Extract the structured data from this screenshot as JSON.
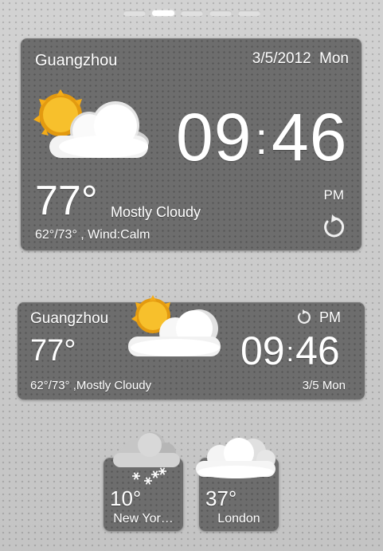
{
  "pager": {
    "count": 5,
    "active_index": 1
  },
  "widget_large": {
    "city": "Guangzhou",
    "date": "3/5/2012",
    "weekday": "Mon",
    "time_hours": "09",
    "time_minutes": "46",
    "ampm": "PM",
    "temperature": "77°",
    "condition": "Mostly Cloudy",
    "details": "62°/73° , Wind:Calm",
    "icon": "partly-cloudy-icon"
  },
  "widget_medium": {
    "city": "Guangzhou",
    "temperature": "77°",
    "details": "62°/73° ,Mostly Cloudy",
    "ampm": "PM",
    "time_hours": "09",
    "time_minutes": "46",
    "date_short": "3/5 Mon",
    "icon": "partly-cloudy-icon"
  },
  "small_widgets": [
    {
      "temperature": "10°",
      "city": "New Yor…",
      "icon": "snow-cloud-icon"
    },
    {
      "temperature": "37°",
      "city": "London",
      "icon": "cloudy-icon"
    }
  ],
  "colors": {
    "panel": "#6d6d6d",
    "background": "#c9c9c9",
    "sun": "#f6b21b"
  }
}
